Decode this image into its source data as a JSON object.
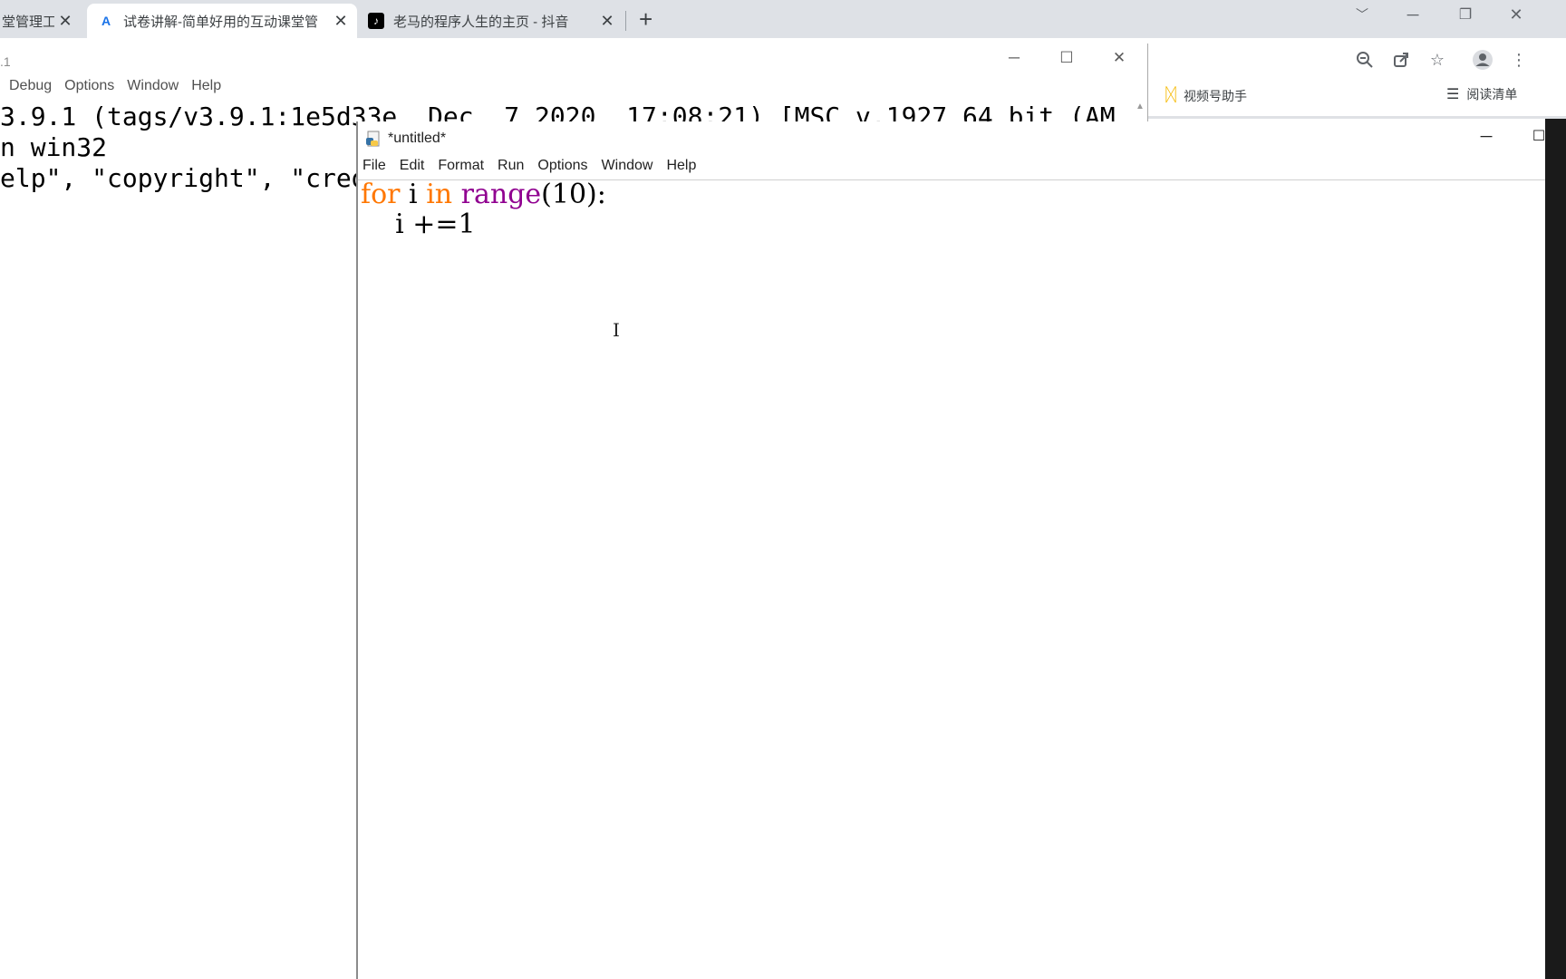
{
  "browser": {
    "tabs": [
      {
        "title": "堂管理工",
        "favicon": "partial",
        "active": false
      },
      {
        "title": "试卷讲解-简单好用的互动课堂管",
        "favicon": "A-logo-icon",
        "active": true
      },
      {
        "title": "老马的程序人生的主页 - 抖音",
        "favicon": "tiktok-icon",
        "active": false
      }
    ],
    "new_tab": "+",
    "bookmarks": [
      {
        "label": "视频号助手",
        "icon": "butterfly-icon"
      },
      {
        "label": "阅读清单",
        "icon": "reading-list-icon"
      }
    ]
  },
  "shell": {
    "title": ".1",
    "menu": [
      "Debug",
      "Options",
      "Window",
      "Help"
    ],
    "lines": [
      "3.9.1 (tags/v3.9.1:1e5d33e, Dec  7 2020, 17:08:21) [MSC v.1927 64 bit (AM",
      "n win32",
      "elp\", \"copyright\", \"credits\" or \"license()\" for more information."
    ]
  },
  "editor": {
    "title": "*untitled*",
    "menu": [
      "File",
      "Edit",
      "Format",
      "Run",
      "Options",
      "Window",
      "Help"
    ],
    "code": {
      "line1": {
        "kw_for": "for",
        "var": " i ",
        "kw_in": "in",
        "sp": " ",
        "builtin": "range",
        "rest": "(10):"
      },
      "line2": "    i +=1"
    }
  },
  "colors": {
    "keyword": "#ff7700",
    "builtin": "#900090"
  }
}
